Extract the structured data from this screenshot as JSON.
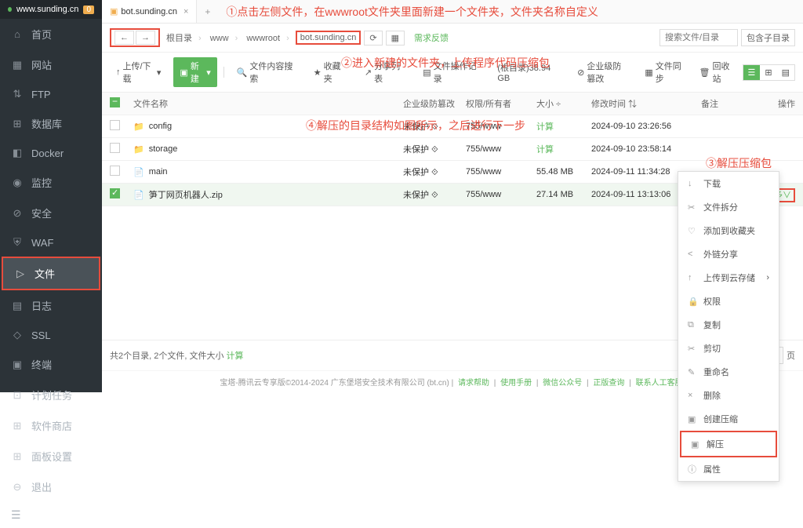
{
  "site": {
    "url": "www.sunding.cn",
    "badge": "0"
  },
  "sidebar": [
    {
      "icon": "⌂",
      "label": "首页"
    },
    {
      "icon": "▦",
      "label": "网站"
    },
    {
      "icon": "⇅",
      "label": "FTP"
    },
    {
      "icon": "⊞",
      "label": "数据库"
    },
    {
      "icon": "◧",
      "label": "Docker"
    },
    {
      "icon": "◉",
      "label": "监控"
    },
    {
      "icon": "⊘",
      "label": "安全"
    },
    {
      "icon": "⛨",
      "label": "WAF"
    },
    {
      "icon": "▷",
      "label": "文件"
    },
    {
      "icon": "▤",
      "label": "日志"
    },
    {
      "icon": "◇",
      "label": "SSL"
    },
    {
      "icon": "▣",
      "label": "终端"
    },
    {
      "icon": "⊡",
      "label": "计划任务"
    },
    {
      "icon": "⊞",
      "label": "软件商店"
    },
    {
      "icon": "⊞",
      "label": "面板设置"
    },
    {
      "icon": "⊖",
      "label": "退出"
    }
  ],
  "tab": {
    "label": "bot.sunding.cn"
  },
  "ann1": "①点击左侧文件，在wwwroot文件夹里面新建一个文件夹，文件夹名称自定义",
  "ann2": "②进入新建的文件夹，上传程序代码压缩包",
  "ann3": "③解压压缩包",
  "ann4": "④解压的目录结构如图所示，之后进行下一步",
  "bc": {
    "back": "←",
    "fwd": "→",
    "root": "根目录",
    "www": "www",
    "wwwroot": "wwwroot",
    "cur": "bot.sunding.cn",
    "refresh": "⟳",
    "feedback": "需求反馈",
    "search_ph": "搜索文件/目录",
    "include": "包含子目录"
  },
  "tb": {
    "upload": "上传/下载",
    "new": "新建",
    "search": "文件内容搜索",
    "fav": "收藏夹",
    "share": "分享列表",
    "ops": "文件操作记录",
    "disk": "(根目录)38.94 GB",
    "defense": "企业级防篡改",
    "sync": "文件同步",
    "recycle": "回收站"
  },
  "th": {
    "name": "文件名称",
    "def": "企业级防篡改",
    "perm": "权限/所有者",
    "size": "大小",
    "time": "修改时间",
    "note": "备注",
    "op": "操作"
  },
  "rows": [
    {
      "chk": false,
      "icon": "folder",
      "name": "config",
      "def": "未保护",
      "perm": "755/www",
      "size": "计算",
      "time": "2024-09-10 23:26:56"
    },
    {
      "chk": false,
      "icon": "folder",
      "name": "storage",
      "def": "未保护",
      "perm": "755/www",
      "size": "计算",
      "time": "2024-09-10 23:58:14"
    },
    {
      "chk": false,
      "icon": "file",
      "name": "main",
      "def": "未保护",
      "perm": "755/www",
      "size": "55.48 MB",
      "time": "2024-09-11 11:34:28"
    },
    {
      "chk": true,
      "icon": "zip",
      "name": "笋丁网页机器人.zip",
      "def": "未保护",
      "perm": "755/www",
      "size": "27.14 MB",
      "time": "2024-09-11 13:13:06"
    }
  ],
  "more": "更多",
  "moresuffix": "∨",
  "ctx": [
    {
      "ic": "↓",
      "label": "下载"
    },
    {
      "ic": "✂",
      "label": "文件拆分"
    },
    {
      "ic": "♡",
      "label": "添加到收藏夹"
    },
    {
      "ic": "<",
      "label": "外链分享"
    },
    {
      "ic": "↑",
      "label": "上传到云存储"
    },
    {
      "ic": "🔒",
      "label": "权限"
    },
    {
      "ic": "⧉",
      "label": "复制"
    },
    {
      "ic": "✂",
      "label": "剪切"
    },
    {
      "ic": "✎",
      "label": "重命名"
    },
    {
      "ic": "×",
      "label": "删除"
    },
    {
      "ic": "▣",
      "label": "创建压缩"
    },
    {
      "ic": "▣",
      "label": "解压"
    },
    {
      "ic": "ⓘ",
      "label": "属性"
    }
  ],
  "footer": {
    "summary": "共2个目录, 2个文件, 文件大小",
    "calc": "计算",
    "per": "500条/页",
    "page": "页"
  },
  "copy": {
    "text": "宝塔-腾讯云专享版©2014-2024 广东堡塔安全技术有限公司 (bt.cn)",
    "links": [
      "请求帮助",
      "使用手册",
      "微信公众号",
      "正版查询",
      "联系人工客服"
    ]
  }
}
